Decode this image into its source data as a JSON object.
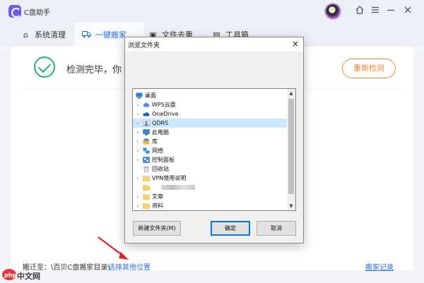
{
  "app": {
    "title": "C盘助手",
    "tabs": [
      {
        "label": "系统清理"
      },
      {
        "label": "一键搬家"
      },
      {
        "label": "文件去重"
      },
      {
        "label": "工具箱"
      }
    ],
    "status_text": "检测完毕，你",
    "rescan_label": "重新检测",
    "footer": {
      "move_to_label": "搬迁至：\\百贝C盘搬家目录\\",
      "choose_location_link": "选择其他位置",
      "records_link": "搬家记录"
    },
    "accent_color": "#2a6fdc",
    "orange_color": "#f08a2c"
  },
  "dialog": {
    "title": "浏览文件夹",
    "close_glyph": "×",
    "tree": [
      {
        "label": "桌面",
        "icon": "desktop-icon",
        "expandable": false,
        "level": 0
      },
      {
        "label": "WPS云盘",
        "icon": "cloud-icon",
        "expandable": true,
        "level": 1
      },
      {
        "label": "OneDrive",
        "icon": "onedrive-icon",
        "expandable": true,
        "level": 1
      },
      {
        "label": "QDRS",
        "icon": "user-icon",
        "expandable": true,
        "level": 1,
        "selected": true
      },
      {
        "label": "此电脑",
        "icon": "computer-icon",
        "expandable": true,
        "level": 1
      },
      {
        "label": "库",
        "icon": "library-icon",
        "expandable": true,
        "level": 1
      },
      {
        "label": "网络",
        "icon": "network-icon",
        "expandable": true,
        "level": 1
      },
      {
        "label": "控制面板",
        "icon": "control-panel-icon",
        "expandable": true,
        "level": 1
      },
      {
        "label": "回收站",
        "icon": "recycle-bin-icon",
        "expandable": false,
        "level": 1
      },
      {
        "label": "VPN使用说明",
        "icon": "folder-icon",
        "expandable": true,
        "level": 1
      },
      {
        "label": "",
        "icon": "folder-icon",
        "expandable": false,
        "level": 1,
        "blurred": true
      },
      {
        "label": "文章",
        "icon": "folder-icon",
        "expandable": true,
        "level": 1
      },
      {
        "label": "资料",
        "icon": "folder-icon",
        "expandable": true,
        "level": 1
      }
    ],
    "new_folder_label": "新建文件夹(M)",
    "ok_label": "确定",
    "cancel_label": "取消"
  },
  "watermark": {
    "text": "中文网"
  }
}
